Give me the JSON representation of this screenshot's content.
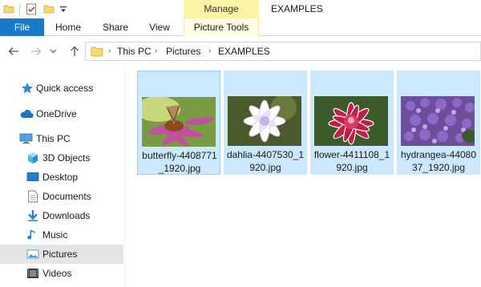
{
  "window": {
    "title": "EXAMPLES",
    "contextual_group": "Manage"
  },
  "ribbon": {
    "tabs": [
      "File",
      "Home",
      "Share",
      "View",
      "Picture Tools"
    ],
    "file_tab_color": "#1979ca",
    "contextual_color": "#fbf3a6"
  },
  "nav": {
    "back_icon": "arrow-left-icon",
    "forward_icon": "arrow-right-icon",
    "recent_icon": "chevron-down-icon",
    "up_icon": "arrow-up-icon",
    "breadcrumb": [
      "This PC",
      "Pictures",
      "EXAMPLES"
    ]
  },
  "sidebar": {
    "items": [
      {
        "label": "Quick access",
        "icon": "star-icon"
      },
      {
        "label": "OneDrive",
        "icon": "cloud-icon"
      },
      {
        "label": "This PC",
        "icon": "computer-icon"
      },
      {
        "label": "3D Objects",
        "icon": "cube-icon"
      },
      {
        "label": "Desktop",
        "icon": "desktop-icon"
      },
      {
        "label": "Documents",
        "icon": "document-icon"
      },
      {
        "label": "Downloads",
        "icon": "download-icon"
      },
      {
        "label": "Music",
        "icon": "music-icon"
      },
      {
        "label": "Pictures",
        "icon": "picture-icon",
        "selected": true
      },
      {
        "label": "Videos",
        "icon": "video-icon"
      }
    ]
  },
  "files": [
    {
      "name": "butterfly-4408771_1920.jpg",
      "line1": "butterfly-4408771",
      "line2": "_1920.jpg"
    },
    {
      "name": "dahlia-4407530_1920.jpg",
      "line1": "dahlia-4407530_1",
      "line2": "920.jpg"
    },
    {
      "name": "flower-4411108_1920.jpg",
      "line1": "flower-4411108_1",
      "line2": "920.jpg"
    },
    {
      "name": "hydrangea-4408037_1920.jpg",
      "line1": "hydrangea-44080",
      "line2": "37_1920.jpg"
    }
  ]
}
